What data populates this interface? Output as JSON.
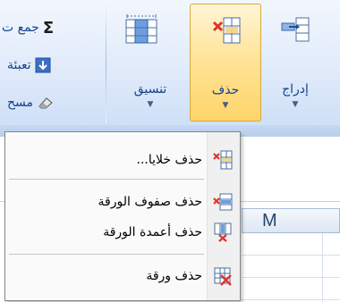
{
  "ribbon": {
    "insert_label": "إدراج",
    "delete_label": "حذف",
    "format_label": "تنسيق",
    "caret": "▼",
    "editing": {
      "autosum_label": "جمع ت",
      "autosum_symbol": "Σ",
      "fill_label": "تعبئة",
      "clear_label": "مسح"
    }
  },
  "spreadsheet": {
    "column_header": "M"
  },
  "delete_menu": {
    "items": [
      {
        "label": "حذف خلايا...",
        "icon": "delete-cells-icon"
      },
      {
        "label": "حذف صفوف الورقة",
        "icon": "delete-rows-icon"
      },
      {
        "label": "حذف أعمدة الورقة",
        "icon": "delete-columns-icon"
      },
      {
        "label": "حذف ورقة",
        "icon": "delete-sheet-icon"
      }
    ]
  },
  "colors": {
    "ribbon_text": "#15428b",
    "active_button": "#ffd46a",
    "delete_red": "#e0342b"
  }
}
